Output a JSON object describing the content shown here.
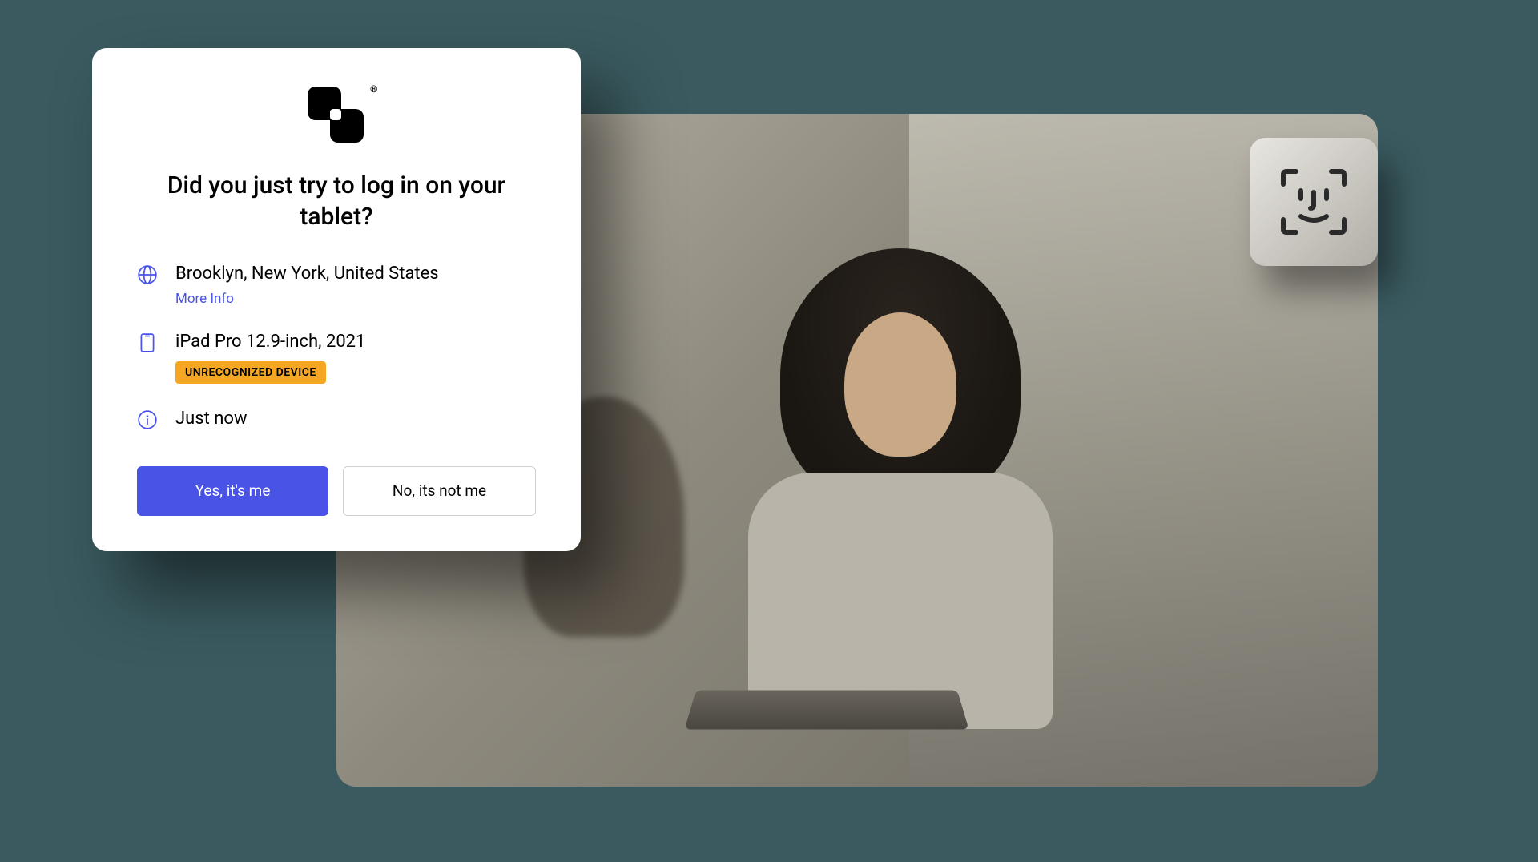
{
  "card": {
    "heading": "Did you just try to log in on your tablet?",
    "location": {
      "text": "Brooklyn, New York, United States",
      "more_info_label": "More Info"
    },
    "device": {
      "text": "iPad Pro 12.9-inch, 2021",
      "badge": "UNRECOGNIZED DEVICE"
    },
    "time": {
      "text": "Just now"
    },
    "actions": {
      "confirm": "Yes, it's me",
      "deny": "No, its not me"
    }
  },
  "logo": {
    "trademark": "®"
  },
  "colors": {
    "accent": "#4953e6",
    "warning": "#f5a623"
  }
}
